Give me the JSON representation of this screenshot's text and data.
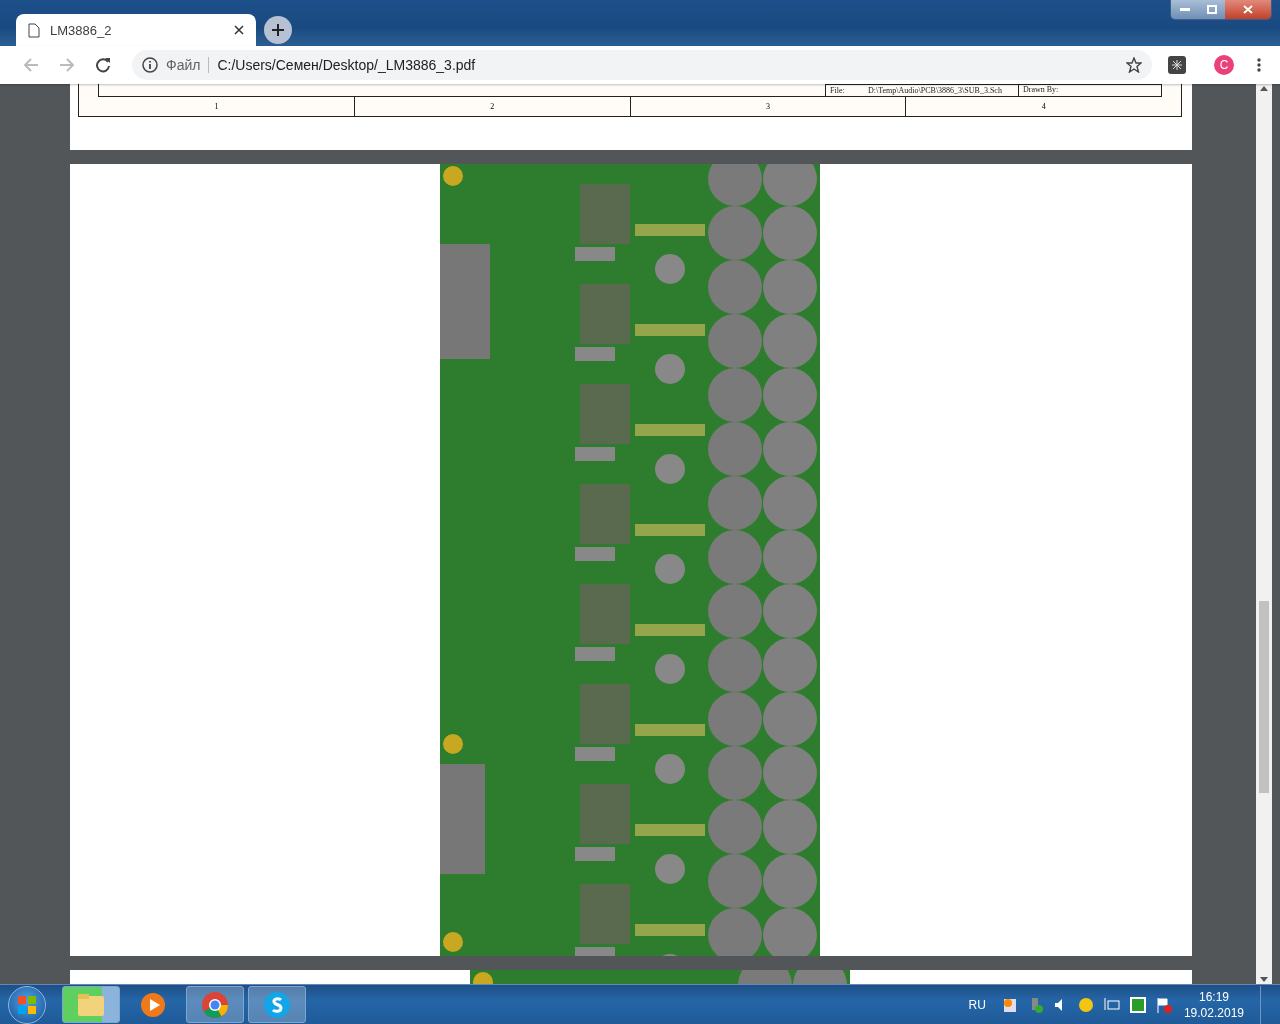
{
  "browser": {
    "tab": {
      "title": "LM3886_2"
    },
    "address": {
      "scheme_label": "Файл",
      "url": "C:/Users/Семен/Desktop/_LM3886_3.pdf"
    },
    "profile_initial": "C"
  },
  "pdf": {
    "title_block": {
      "file_label": "File:",
      "file_path": "D:\\Temp\\Audio\\PCB\\3886_3\\SUB_3.Sch",
      "drawn_by_label": "Drawn By:"
    },
    "column_numbers": [
      "1",
      "2",
      "3",
      "4"
    ]
  },
  "taskbar": {
    "apps": [
      {
        "kind": "explorer"
      },
      {
        "kind": "media"
      },
      {
        "kind": "browser"
      },
      {
        "kind": "chat"
      }
    ],
    "language": "RU",
    "time": "16:19",
    "date": "19.02.2019"
  }
}
